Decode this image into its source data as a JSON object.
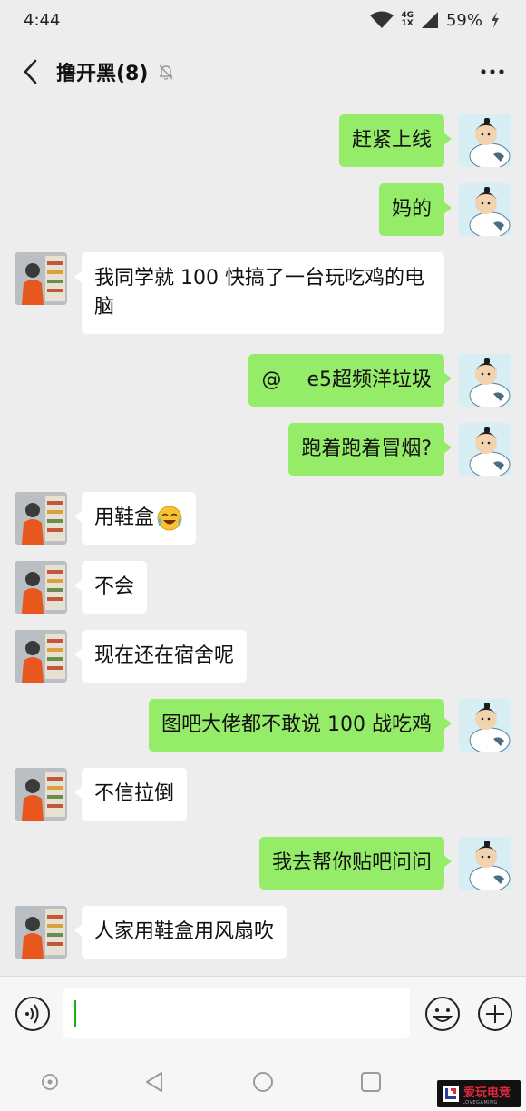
{
  "status_bar": {
    "time": "4:44",
    "network_top": "4G",
    "network_bottom": "1X",
    "battery": "59%"
  },
  "header": {
    "title": "撸开黑(8)"
  },
  "messages": [
    {
      "side": "right",
      "text": "赶紧上线"
    },
    {
      "side": "right",
      "text": "妈的"
    },
    {
      "side": "left",
      "text": "我同学就 100 快搞了一台玩吃鸡的电脑"
    },
    {
      "side": "right",
      "text": "@    e5超频洋垃圾"
    },
    {
      "side": "right",
      "text": "跑着跑着冒烟?"
    },
    {
      "side": "left",
      "text": "用鞋盒",
      "emoji": "crying-laughing-emoji"
    },
    {
      "side": "left",
      "text": "不会"
    },
    {
      "side": "left",
      "text": "现在还在宿舍呢"
    },
    {
      "side": "right",
      "text": "图吧大佬都不敢说 100 战吃鸡"
    },
    {
      "side": "left",
      "text": "不信拉倒"
    },
    {
      "side": "right",
      "text": "我去帮你贴吧问问"
    },
    {
      "side": "left",
      "text": "人家用鞋盒用风扇吹"
    }
  ],
  "input": {
    "value": ""
  },
  "watermark": {
    "text": "爱玩电竞",
    "subtext": "LOVEGAMING"
  },
  "colors": {
    "background": "#ededed",
    "my_bubble": "#95ec69",
    "their_bubble": "#ffffff",
    "caret": "#1aad19",
    "watermark": "#e2283a"
  },
  "icons": [
    "back-arrow-icon",
    "mute-bell-icon",
    "more-icon",
    "voice-icon",
    "emoji-icon",
    "plus-icon",
    "recent-apps-icon",
    "back-triangle-icon",
    "home-circle-icon",
    "square-icon",
    "wifi-icon",
    "signal-icon",
    "battery-charging-icon"
  ]
}
